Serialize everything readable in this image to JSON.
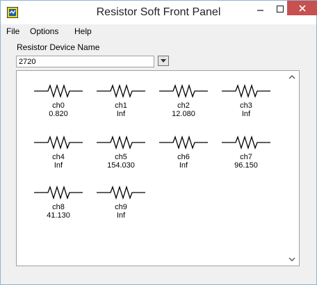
{
  "window": {
    "title": "Resistor Soft Front Panel"
  },
  "menu": {
    "items": [
      "File",
      "Options",
      "Help"
    ]
  },
  "device": {
    "label": "Resistor Device Name",
    "value": "2720"
  },
  "channels": [
    {
      "name": "ch0",
      "value": "0.820"
    },
    {
      "name": "ch1",
      "value": "Inf"
    },
    {
      "name": "ch2",
      "value": "12.080"
    },
    {
      "name": "ch3",
      "value": "Inf"
    },
    {
      "name": "ch4",
      "value": "Inf"
    },
    {
      "name": "ch5",
      "value": "154.030"
    },
    {
      "name": "ch6",
      "value": "Inf"
    },
    {
      "name": "ch7",
      "value": "96.150"
    },
    {
      "name": "ch8",
      "value": "41.130"
    },
    {
      "name": "ch9",
      "value": "Inf"
    }
  ],
  "icons": {
    "app": "labview-vi-icon",
    "minimize": "minimize-icon",
    "maximize": "maximize-icon",
    "close": "close-icon",
    "dropdown": "chevron-down-icon",
    "resistor": "resistor-icon",
    "scroll_up": "chevron-up-icon",
    "scroll_down": "chevron-down-icon"
  },
  "colors": {
    "close_button": "#c75050",
    "window_border": "#8fb3d9"
  }
}
